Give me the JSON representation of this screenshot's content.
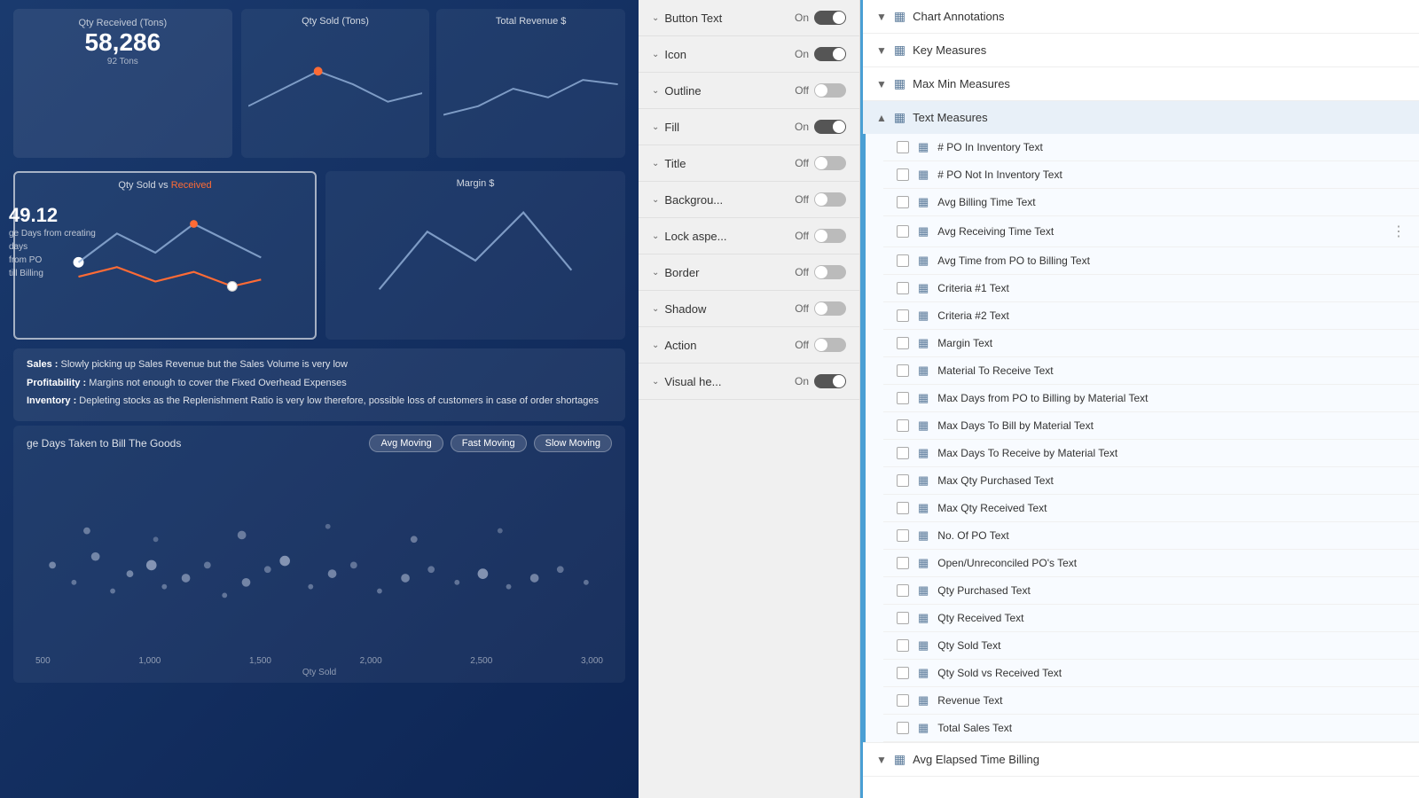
{
  "dashboard": {
    "metric1": {
      "label": "Qty Received (Tons)",
      "value": "58,286",
      "sub": "92 Tons"
    },
    "chart1_title": "Qty Sold (Tons)",
    "chart2_title": "Total Revenue $",
    "chart3_title_part1": "Qty Sold vs ",
    "chart3_title_part2": "Received",
    "chart4_title": "Margin $",
    "analysis": {
      "sales": "Sales : Slowly picking up Sales Revenue but the Sales Volume is very low",
      "profitability": "Profitability : Margins not enough to cover the Fixed Overhead Expenses",
      "inventory": "Inventory : Depleting stocks as the Replenishment Ratio is very low therefore, possible loss of customers in case of order shortages"
    },
    "bottom_chart_title": "ge Days Taken to Bill The Goods",
    "filters": [
      "Avg Moving",
      "Fast Moving",
      "Slow Moving"
    ],
    "x_axis_labels": [
      "500",
      "1,000",
      "1,500",
      "2,000",
      "2,500",
      "3,000"
    ],
    "x_axis_title": "Qty Sold",
    "value2": "49.12",
    "label2": "ge Days from creating\ndays\nfrom PO\ntill Billing"
  },
  "properties": [
    {
      "name": "Button Text",
      "state": "On",
      "on": true
    },
    {
      "name": "Icon",
      "state": "On",
      "on": true
    },
    {
      "name": "Outline",
      "state": "Off",
      "on": false
    },
    {
      "name": "Fill",
      "state": "On",
      "on": true
    },
    {
      "name": "Title",
      "state": "Off",
      "on": false
    },
    {
      "name": "Backgrou...",
      "state": "Off",
      "on": false
    },
    {
      "name": "Lock aspe...",
      "state": "Off",
      "on": false
    },
    {
      "name": "Border",
      "state": "Off",
      "on": false
    },
    {
      "name": "Shadow",
      "state": "Off",
      "on": false
    },
    {
      "name": "Action",
      "state": "Off",
      "on": false
    },
    {
      "name": "Visual he...",
      "state": "On",
      "on": true
    }
  ],
  "tree": {
    "sections": [
      {
        "id": "chart-annotations",
        "title": "Chart Annotations",
        "expanded": false,
        "items": []
      },
      {
        "id": "key-measures",
        "title": "Key Measures",
        "expanded": false,
        "items": []
      },
      {
        "id": "max-min-measures",
        "title": "Max Min Measures",
        "expanded": false,
        "items": []
      },
      {
        "id": "text-measures",
        "title": "Text Measures",
        "expanded": true,
        "items": [
          "# PO In Inventory Text",
          "# PO Not In Inventory Text",
          "Avg Billing Time Text",
          "Avg Receiving Time Text",
          "Avg Time from PO to Billing Text",
          "Criteria #1 Text",
          "Criteria #2 Text",
          "Margin Text",
          "Material To Receive Text",
          "Max Days from PO to Billing by Material Text",
          "Max Days To Bill by Material Text",
          "Max Days To Receive by Material Text",
          "Max Qty Purchased Text",
          "Max Qty Received Text",
          "No. Of PO Text",
          "Open/Unreconciled PO's Text",
          "Qty Purchased Text",
          "Qty Received Text",
          "Qty Sold Text",
          "Qty Sold vs Received Text",
          "Revenue Text",
          "Total Sales Text"
        ]
      },
      {
        "id": "avg-elapsed-billing",
        "title": "Avg Elapsed Time Billing",
        "expanded": false,
        "items": []
      }
    ]
  }
}
